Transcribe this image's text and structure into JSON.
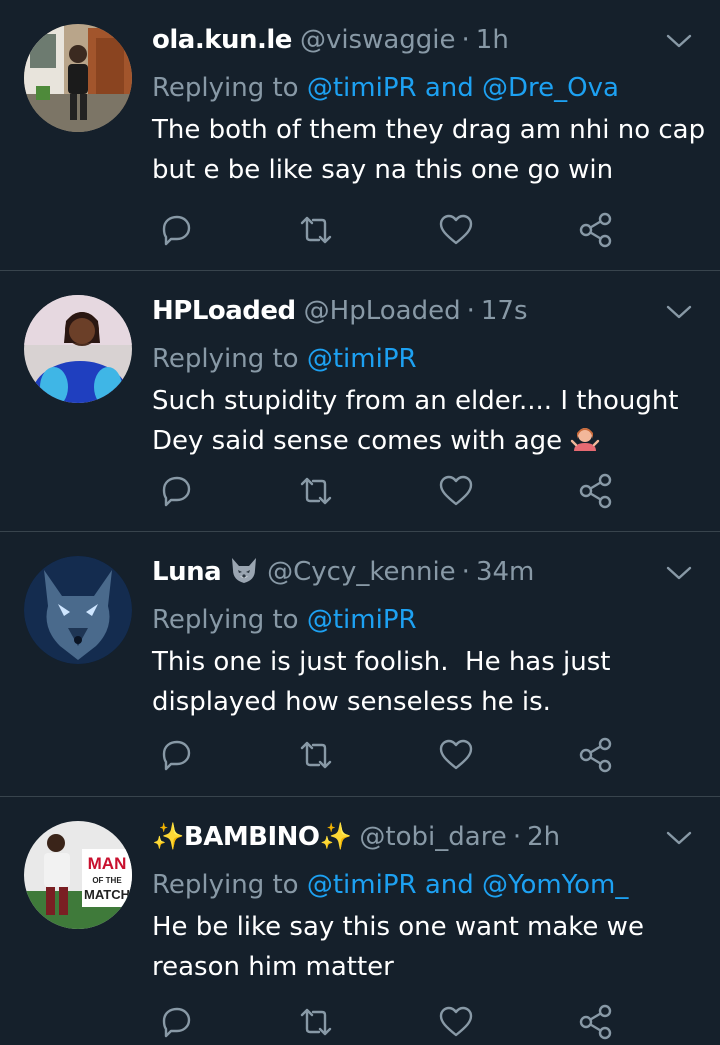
{
  "tweets": [
    {
      "name": "ola.kun.le",
      "handle": "@viswaggie",
      "dot": "·",
      "time": "1h",
      "replying_prefix": "Replying to",
      "mentions": "@timiPR and @Dre_Ova",
      "body_lines": [
        "The both of them they drag am nhi no cap",
        "but e be like say na this one go win"
      ]
    },
    {
      "name": "HPLoaded",
      "handle": "@HpLoaded",
      "dot": "·",
      "time": "17s",
      "replying_prefix": "Replying to",
      "mentions": "@timiPR",
      "body_lines": [
        "Such stupidity from an elder.... I thought",
        "Dey said sense comes with age"
      ],
      "body_emoji": "person-shrugging-emoji"
    },
    {
      "name": "Luna",
      "name_emoji": "wolf-emoji",
      "handle": "@Cycy_kennie",
      "dot": "·",
      "time": "34m",
      "replying_prefix": "Replying to",
      "mentions": "@timiPR",
      "body_lines": [
        "This one is just foolish.  He has just",
        "displayed how senseless he is."
      ]
    },
    {
      "name": "✨BAMBINO✨",
      "handle": "@tobi_dare",
      "dot": "·",
      "time": "2h",
      "replying_prefix": "Replying to",
      "mentions": "@timiPR and @YomYom_",
      "body_lines": [
        "He be like say this one want make we",
        "reason him matter"
      ],
      "avatar_text": [
        "MAN",
        "OF THE",
        "MATCH"
      ]
    }
  ],
  "icons": [
    "reply-icon",
    "retweet-icon",
    "like-icon",
    "share-icon",
    "caret-down-icon"
  ],
  "colors": {
    "background": "#15202b",
    "divider": "#38444d",
    "secondary_text": "#8899a6",
    "link": "#1da1f2"
  }
}
